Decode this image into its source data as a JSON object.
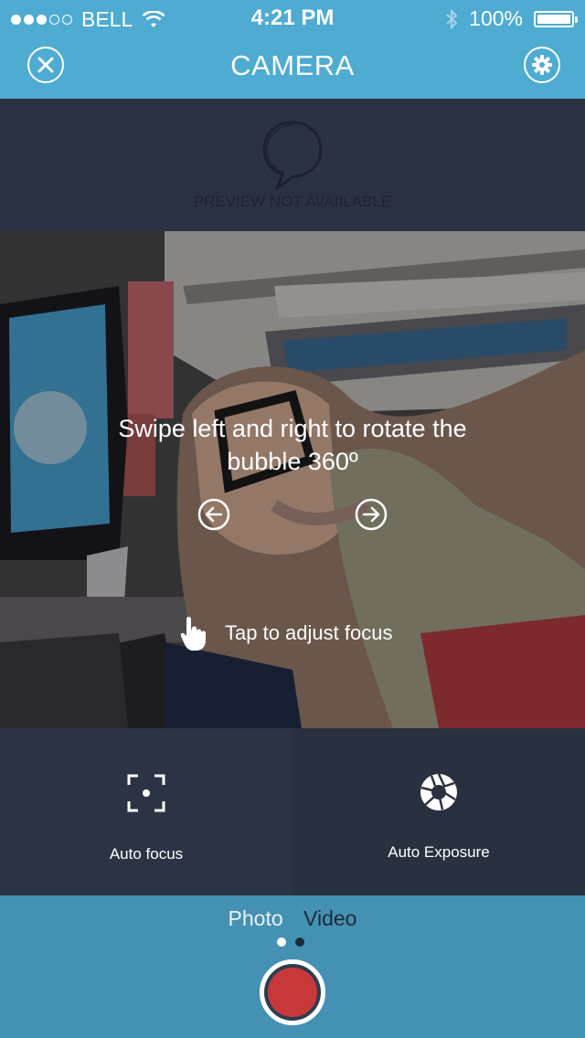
{
  "status": {
    "carrier": "BELL",
    "time": "4:21 PM",
    "battery": "100%",
    "signal_bars_filled": 3,
    "signal_bars_total": 5
  },
  "nav": {
    "title": "CAMERA",
    "close_icon": "close-icon",
    "settings_icon": "gear-icon"
  },
  "preview": {
    "text": "PREVIEW NOT AVAIILABLE",
    "icon": "speech-bubble-icon"
  },
  "camera": {
    "hint_line1": "Swipe left and right to rotate the",
    "hint_line2": "bubble 360º",
    "focus_hint": "Tap to adjust focus"
  },
  "controls": {
    "focus_label": "Auto focus",
    "exposure_label": "Auto Exposure"
  },
  "modes": {
    "photo": "Photo",
    "video": "Video",
    "active": "Photo"
  },
  "colors": {
    "accent": "#4eabd2",
    "bottom_bar": "#4591b4",
    "record": "#c8383a",
    "panel": "#2b3344"
  }
}
